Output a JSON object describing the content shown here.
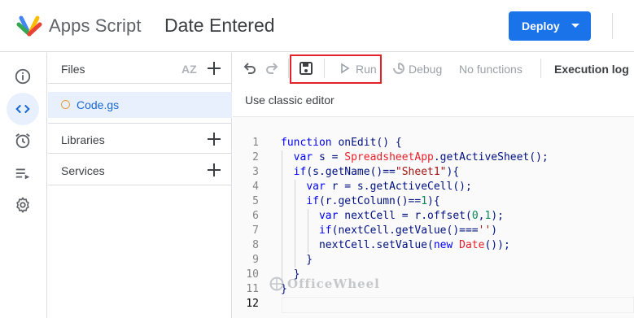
{
  "header": {
    "app_name": "Apps Script",
    "project_title": "Date Entered",
    "deploy_label": "Deploy"
  },
  "rail": {
    "items": [
      "overview-icon",
      "editor-icon",
      "triggers-icon",
      "executions-icon",
      "settings-icon"
    ],
    "active": "editor-icon"
  },
  "files_panel": {
    "files_label": "Files",
    "sort_label": "AZ",
    "files": [
      "Code.gs"
    ],
    "libraries_label": "Libraries",
    "services_label": "Services"
  },
  "toolbar": {
    "run_label": "Run",
    "debug_label": "Debug",
    "functions_label": "No functions",
    "execution_log_label": "Execution log",
    "classic_editor_label": "Use classic editor"
  },
  "editor": {
    "line_numbers": [
      "1",
      "2",
      "3",
      "4",
      "5",
      "6",
      "7",
      "8",
      "9",
      "10",
      "11",
      "12"
    ],
    "code_lines": [
      "function onEdit() {",
      "  var s = SpreadsheetApp.getActiveSheet();",
      "  if(s.getName()==\"Sheet1\"){",
      "    var r = s.getActiveCell();",
      "    if(r.getColumn()==1){",
      "      var nextCell = r.offset(0,1);",
      "      if(nextCell.getValue()==='')",
      "      nextCell.setValue(new Date());",
      "    }",
      "  }",
      "}",
      ""
    ]
  },
  "watermark": {
    "text": "OfficeWheel"
  },
  "colors": {
    "accent": "#1a73e8",
    "highlight_box": "#e8202a",
    "active_file_bg": "#e8f0fe"
  }
}
